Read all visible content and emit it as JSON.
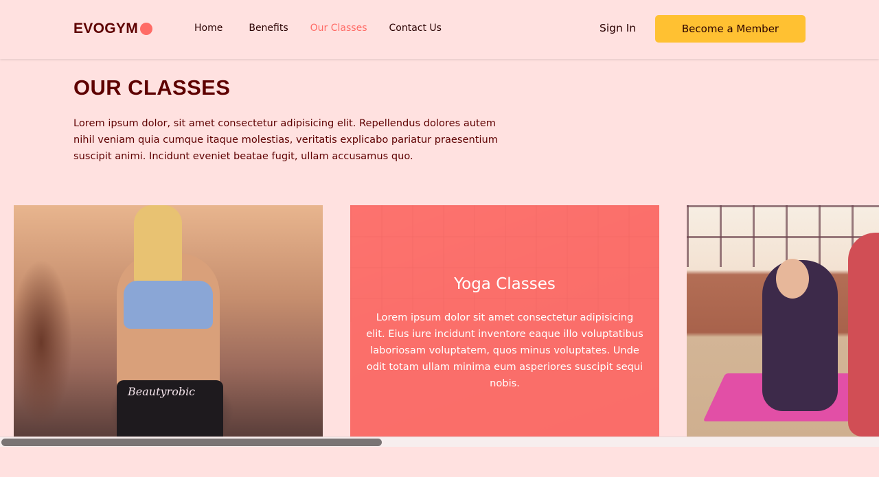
{
  "brand": {
    "logo_text": "EVOGYM",
    "accent": "#FF6B66",
    "button_color": "#FFC132",
    "text_color": "#5E0000",
    "background": "#FFE1E0"
  },
  "nav": {
    "links": [
      {
        "label": "Home",
        "active": false
      },
      {
        "label": "Benefits",
        "active": false
      },
      {
        "label": "Our Classes",
        "active": true
      },
      {
        "label": "Contact Us",
        "active": false
      }
    ],
    "sign_in": "Sign In",
    "cta": "Become a Member"
  },
  "section": {
    "title": "OUR CLASSES",
    "intro": "Lorem ipsum dolor, sit amet consectetur adipisicing elit. Repellendus dolores autem nihil veniam quia cumque itaque molestias, veritatis explicabo pariatur praesentium suscipit animi. Incidunt eveniet beatae fugit, ullam accusamus quo."
  },
  "classes": [
    {
      "image": "weight-training-photo",
      "print_text": "Beautyrobic"
    },
    {
      "image": "yoga-classes-photo",
      "title": "Yoga Classes",
      "description": "Lorem ipsum dolor sit amet consectetur adipisicing elit. Eius iure incidunt inventore eaque illo voluptatibus laboriosam voluptatem, quos minus voluptates. Unde odit totam ullam minima eum asperiores suscipit sequi nobis."
    },
    {
      "image": "yoga-mat-photo"
    }
  ],
  "scrollbar": {
    "position_fraction": 0.0
  }
}
